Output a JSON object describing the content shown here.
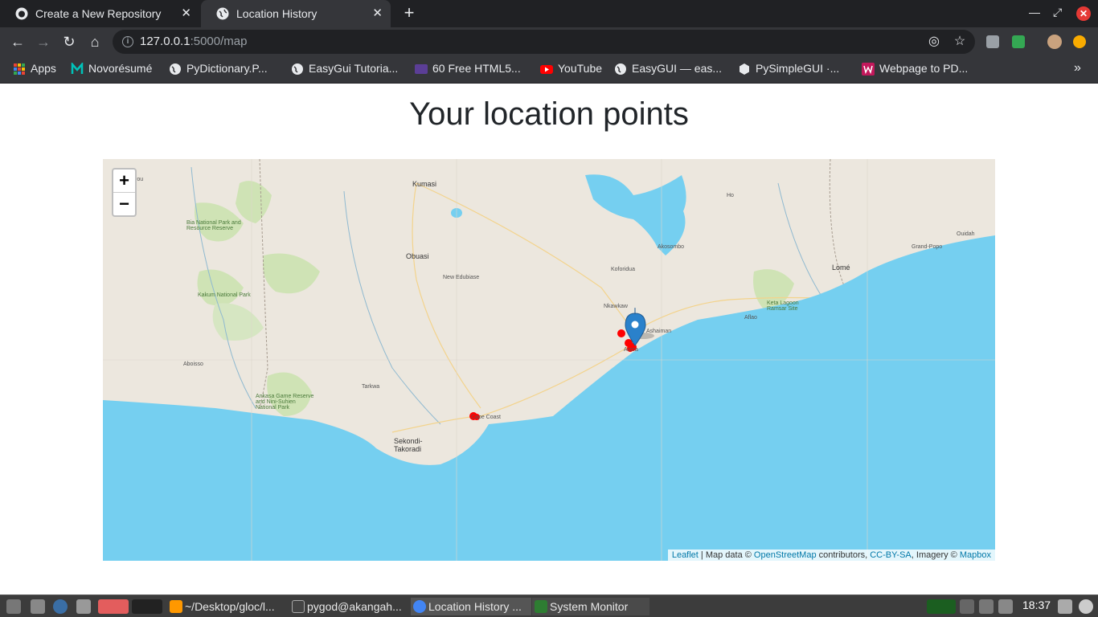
{
  "browser": {
    "tabs": [
      {
        "title": "Create a New Repository",
        "icon": "github-icon"
      },
      {
        "title": "Location History",
        "icon": "globe-icon"
      }
    ],
    "url_host": "127.0.0.1",
    "url_rest": ":5000/map",
    "bookmarks": [
      {
        "label": "Apps",
        "icon": "apps-grid-icon"
      },
      {
        "label": "Novorésumé",
        "icon": "novoresume-icon"
      },
      {
        "label": "PyDictionary.P...",
        "icon": "globe-icon"
      },
      {
        "label": "EasyGui Tutoria...",
        "icon": "globe-icon"
      },
      {
        "label": "60 Free HTML5...",
        "icon": "colorlib-icon"
      },
      {
        "label": "YouTube",
        "icon": "youtube-icon"
      },
      {
        "label": "EasyGUI — eas...",
        "icon": "globe-icon"
      },
      {
        "label": "PySimpleGUI ·...",
        "icon": "hexagon-icon"
      },
      {
        "label": "Webpage to PD...",
        "icon": "webpage-pdf-icon"
      }
    ]
  },
  "page": {
    "title": "Your location points"
  },
  "map": {
    "zoom_in": "+",
    "zoom_out": "−",
    "labels": {
      "kumasi": "Kumasi",
      "obuasi": "Obuasi",
      "sekondi": "Sekondi-\nTakoradi",
      "cape_coast": "Cape Coast",
      "accra": "Accra",
      "ashaiman": "Ashaiman",
      "lome": "Lomé",
      "abengourou": "Abengourou",
      "koforidua": "Koforidua",
      "new_edubiase": "New Edubiase",
      "aboisso": "Aboisso",
      "akosombo": "Akosombo",
      "ho": "Ho",
      "aflao": "Aflao",
      "tarkwa": "Tarkwa",
      "nkawkaw": "Nkawkaw",
      "bia_park": "Bia National Park and\nResource Reserve",
      "kakum": "Kakum National Park",
      "ankasa": "Ankasa Game Reserve\nand Nini-Suhien\nNational Park",
      "keta": "Keta Lagoon\nRamsar Site",
      "grand_popo": "Grand-Popo",
      "ouidah": "Ouidah"
    },
    "attribution": {
      "leaflet": "Leaflet",
      "sep1": " | Map data © ",
      "osm": "OpenStreetMap",
      "mid": " contributors, ",
      "license": "CC-BY-SA",
      "mid2": ", Imagery © ",
      "mapbox": "Mapbox"
    },
    "marker_color": "#ff0000",
    "pin_color": "#2a81cb",
    "sea_color": "#75cff0",
    "land_color": "#ece7de"
  },
  "taskbar": {
    "tasks": [
      {
        "label": "~/Desktop/gloc/l...",
        "icon": "sublime-icon"
      },
      {
        "label": "pygod@akangah...",
        "icon": "terminal-icon"
      },
      {
        "label": "Location History ...",
        "icon": "chrome-icon"
      },
      {
        "label": "System Monitor",
        "icon": "system-monitor-icon"
      }
    ],
    "clock": "18:37"
  }
}
